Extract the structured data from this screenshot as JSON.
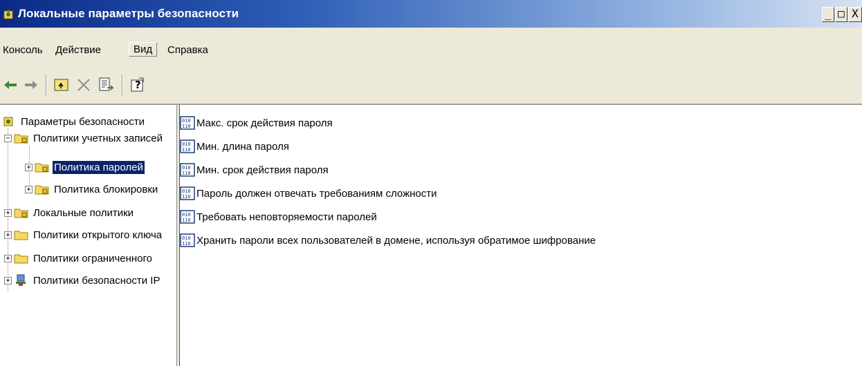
{
  "window": {
    "title": "Локальные параметры безопасности",
    "controls": {
      "minimize": "_",
      "maximize": "□",
      "close": "X"
    }
  },
  "menu": {
    "items": [
      {
        "label": "Консоль"
      },
      {
        "label": "Действие"
      },
      {
        "label": "Вид"
      },
      {
        "label": "Справка"
      }
    ]
  },
  "toolbar": {
    "back_icon": "back-arrow-icon",
    "forward_icon": "forward-arrow-icon",
    "up_icon": "up-folder-icon",
    "delete_icon": "delete-icon",
    "export_icon": "export-list-icon",
    "help_icon": "help-icon"
  },
  "tree": {
    "root": "Параметры безопасности",
    "items": [
      {
        "label": "Политики учетных записей"
      },
      {
        "label": "Политика паролей"
      },
      {
        "label": "Политика блокировки"
      },
      {
        "label": "Локальные политики"
      },
      {
        "label": "Политики открытого ключа"
      },
      {
        "label": "Политики ограниченного"
      },
      {
        "label": "Политики безопасности IP"
      }
    ],
    "selected": "Политика паролей"
  },
  "list": {
    "items": [
      {
        "label": "Макс. срок действия пароля"
      },
      {
        "label": "Мин. длина пароля"
      },
      {
        "label": "Мин. срок действия пароля"
      },
      {
        "label": "Пароль должен отвечать требованиям сложности"
      },
      {
        "label": "Требовать неповторяемости паролей"
      },
      {
        "label": "Хранить пароли всех пользователей в домене, используя обратимое шифрование"
      }
    ]
  },
  "colors": {
    "title_start": "#0b2a86",
    "title_end": "#d6e2f3",
    "selection": "#0a246a",
    "chrome": "#ece9d8"
  }
}
